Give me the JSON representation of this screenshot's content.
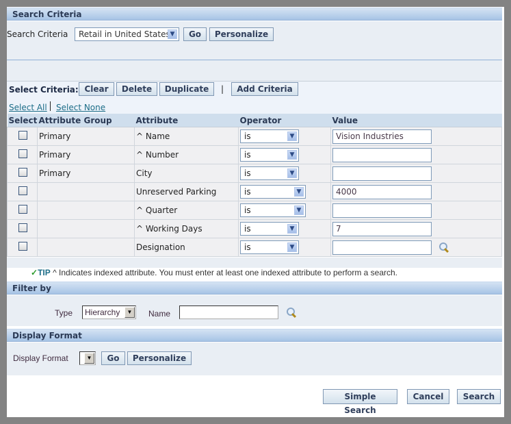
{
  "search_criteria": {
    "header": "Search Criteria",
    "label": "Search Criteria",
    "selected": "Retail in United States",
    "go_label": "Go",
    "personalize_label": "Personalize"
  },
  "select_criteria": {
    "label": "Select Criteria:",
    "clear_label": "Clear",
    "delete_label": "Delete",
    "duplicate_label": "Duplicate",
    "separator": "|",
    "add_label": "Add Criteria",
    "select_all": "Select All",
    "select_none": "Select None"
  },
  "table": {
    "columns": [
      "Select",
      "Attribute Group",
      "Attribute",
      "Operator",
      "Value"
    ],
    "rows": [
      {
        "group": "Primary",
        "attribute": "^ Name",
        "operator": "is",
        "value": "Vision Industries"
      },
      {
        "group": "Primary",
        "attribute": "^ Number",
        "operator": "is",
        "value": ""
      },
      {
        "group": "Primary",
        "attribute": "City",
        "operator": "is",
        "value": ""
      },
      {
        "group": "",
        "attribute": "Unreserved Parking",
        "operator": "is",
        "value": "4000"
      },
      {
        "group": "",
        "attribute": "^ Quarter",
        "operator": "is",
        "value": ""
      },
      {
        "group": "",
        "attribute": "^ Working Days",
        "operator": "is",
        "value": "7"
      },
      {
        "group": "",
        "attribute": "Designation",
        "operator": "is",
        "value": ""
      }
    ]
  },
  "tip": {
    "label": "TIP",
    "text": "^ Indicates indexed attribute. You must enter at least one indexed attribute to perform a search."
  },
  "filter_by": {
    "header": "Filter by",
    "type_label": "Type",
    "type_selected": "Hierarchy",
    "name_label": "Name",
    "name_value": ""
  },
  "display_format": {
    "header": "Display Format",
    "label": "Display Format",
    "selected": "",
    "go_label": "Go",
    "personalize_label": "Personalize"
  },
  "footer": {
    "simple_search_label": "Simple Search",
    "cancel_label": "Cancel",
    "search_label": "Search"
  }
}
